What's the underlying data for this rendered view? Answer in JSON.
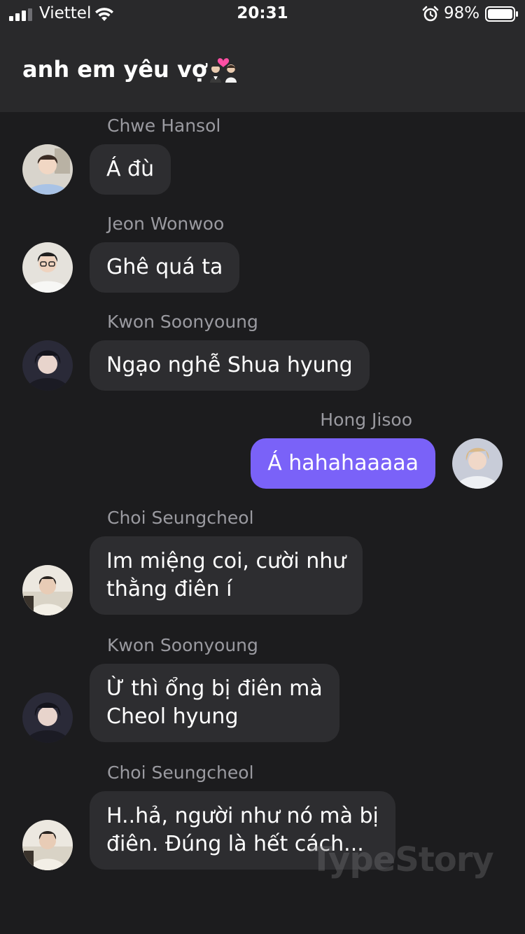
{
  "status_bar": {
    "carrier": "Viettel",
    "time": "20:31",
    "battery_percent": "98%",
    "icons": [
      "signal-icon",
      "wifi-icon",
      "alarm-icon",
      "battery-icon"
    ]
  },
  "header": {
    "title": "anh em yêu vợ",
    "title_emoji": "couple-with-heart-icon"
  },
  "messages": [
    {
      "sender": "Chwe Hansol",
      "text": "Á đù",
      "direction": "incoming"
    },
    {
      "sender": "Jeon Wonwoo",
      "text": "Ghê quá ta",
      "direction": "incoming"
    },
    {
      "sender": "Kwon Soonyoung",
      "text": "Ngạo nghễ Shua hyung",
      "direction": "incoming"
    },
    {
      "sender": "Hong Jisoo",
      "text": "Á hahahaaaaa",
      "direction": "outgoing"
    },
    {
      "sender": "Choi Seungcheol",
      "text": "Im miệng coi, cười như\nthằng điên í",
      "direction": "incoming"
    },
    {
      "sender": "Kwon Soonyoung",
      "text": "Ừ thì ổng bị điên mà\nCheol hyung",
      "direction": "incoming"
    },
    {
      "sender": "Choi Seungcheol",
      "text": "H..hả, người như nó mà bị\nđiên. Đúng là hết cách...",
      "direction": "incoming"
    }
  ],
  "watermark": "TypeStory",
  "colors": {
    "background": "#1c1c1e",
    "header": "#29292b",
    "incoming_bubble": "#2d2d30",
    "outgoing_bubble": "#7a62f8",
    "sender_name": "#9a9aa0"
  }
}
